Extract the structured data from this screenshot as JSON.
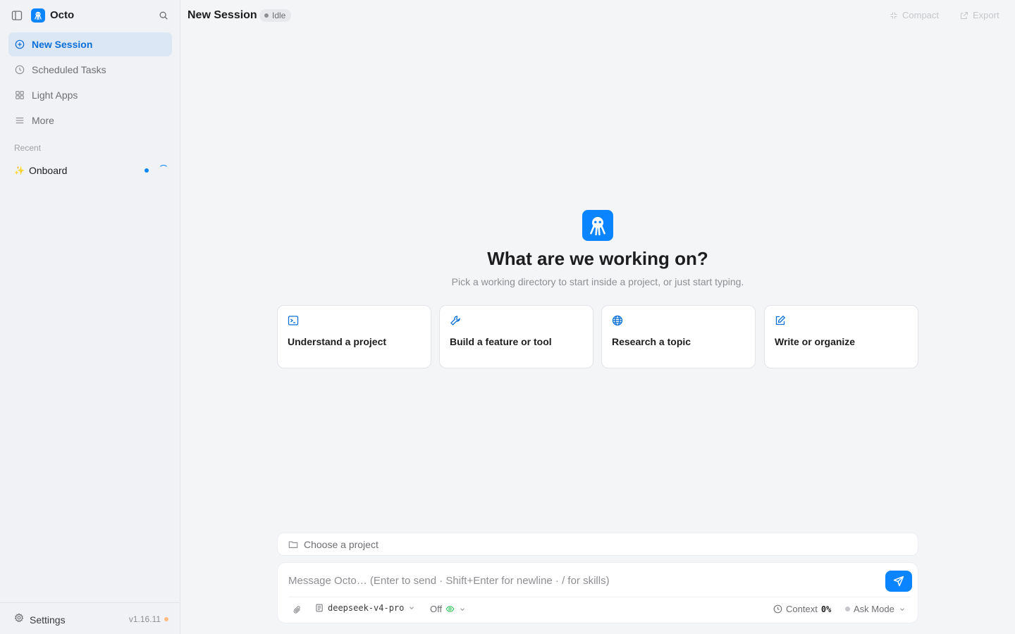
{
  "app": {
    "title": "Octo"
  },
  "sidebar": {
    "items": [
      {
        "label": "New Session",
        "icon": "plus-circle-icon",
        "active": true
      },
      {
        "label": "Scheduled Tasks",
        "icon": "clock-icon"
      },
      {
        "label": "Light Apps",
        "icon": "grid-icon"
      },
      {
        "label": "More",
        "icon": "menu-icon"
      }
    ],
    "recent_label": "Recent",
    "recent": [
      {
        "label": "Onboard",
        "icon": "sparkle-icon"
      }
    ],
    "settings_label": "Settings",
    "version": "v1.16.11"
  },
  "header": {
    "title": "New Session",
    "status": "Idle",
    "compact_label": "Compact",
    "export_label": "Export"
  },
  "hero": {
    "title": "What are we working on?",
    "subtitle": "Pick a working directory to start inside a project, or just start typing."
  },
  "cards": [
    {
      "label": "Understand a project",
      "icon": "terminal-icon"
    },
    {
      "label": "Build a feature or tool",
      "icon": "wrench-icon"
    },
    {
      "label": "Research a topic",
      "icon": "globe-icon"
    },
    {
      "label": "Write or organize",
      "icon": "edit-icon"
    }
  ],
  "project": {
    "label": "Choose a project"
  },
  "composer": {
    "placeholder": "Message Octo… (Enter to send · Shift+Enter for newline · / for skills)",
    "model": "deepseek-v4-pro",
    "toggle": "Off",
    "context_label": "Context",
    "context_value": "0%",
    "mode": "Ask Mode"
  },
  "colors": {
    "accent": "#0a84ff",
    "sidebar_bg": "#f1f2f5",
    "main_bg": "#f4f5f7"
  }
}
